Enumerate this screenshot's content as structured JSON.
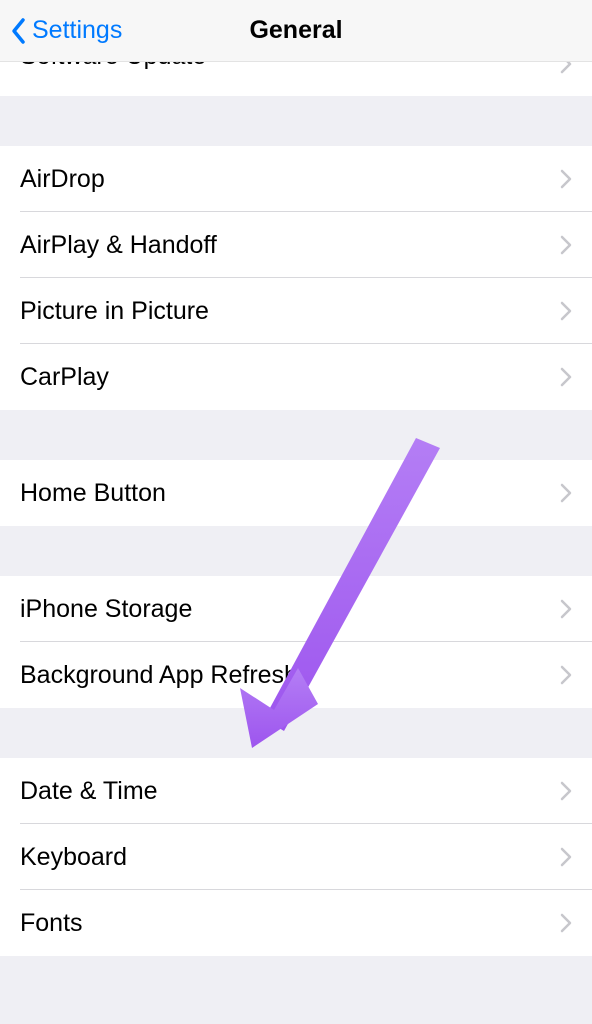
{
  "nav": {
    "back_label": "Settings",
    "title": "General"
  },
  "partial_row": {
    "label": "Software Update"
  },
  "groups": [
    {
      "rows": [
        {
          "name": "airdrop",
          "label": "AirDrop"
        },
        {
          "name": "airplay-handoff",
          "label": "AirPlay & Handoff"
        },
        {
          "name": "picture-in-picture",
          "label": "Picture in Picture"
        },
        {
          "name": "carplay",
          "label": "CarPlay"
        }
      ]
    },
    {
      "rows": [
        {
          "name": "home-button",
          "label": "Home Button"
        }
      ]
    },
    {
      "rows": [
        {
          "name": "iphone-storage",
          "label": "iPhone Storage"
        },
        {
          "name": "background-app-refresh",
          "label": "Background App Refresh"
        }
      ]
    },
    {
      "rows": [
        {
          "name": "date-time",
          "label": "Date & Time"
        },
        {
          "name": "keyboard",
          "label": "Keyboard"
        },
        {
          "name": "fonts",
          "label": "Fonts"
        }
      ]
    }
  ],
  "annotation": {
    "color": "#a864f0"
  }
}
